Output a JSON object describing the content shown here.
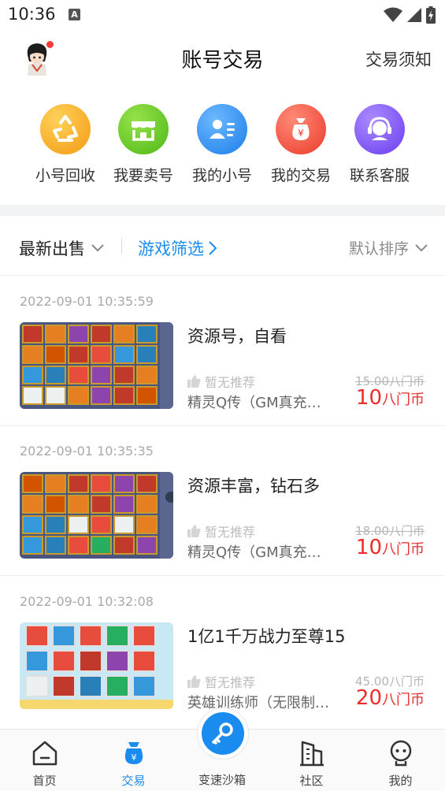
{
  "status_bar": {
    "time": "10:36",
    "a_badge": "A"
  },
  "header": {
    "title": "账号交易",
    "notice": "交易须知"
  },
  "quick_actions": [
    {
      "label": "小号回收",
      "icon": "recycle-icon",
      "color": "#f7a21a"
    },
    {
      "label": "我要卖号",
      "icon": "storefront-icon",
      "color": "#5cc31f"
    },
    {
      "label": "我的小号",
      "icon": "id-card-icon",
      "color": "#2b8bf2"
    },
    {
      "label": "我的交易",
      "icon": "money-bag-icon",
      "color": "#f04a3c"
    },
    {
      "label": "联系客服",
      "icon": "headset-icon",
      "color": "#7c4ff0"
    }
  ],
  "filters": {
    "latest": "最新出售",
    "game_filter": "游戏筛选",
    "sort": "默认排序"
  },
  "listings": [
    {
      "time": "2022-09-01 10:35:59",
      "title": "资源号，自看",
      "recommend": "暂无推荐",
      "game": "精灵Q传（GM真充版）",
      "original_price": "15.00八门币",
      "price": "10",
      "unit": "八门币",
      "strike": true
    },
    {
      "time": "2022-09-01 10:35:35",
      "title": "资源丰富，钻石多",
      "recommend": "暂无推荐",
      "game": "精灵Q传（GM真充版）",
      "original_price": "18.00八门币",
      "price": "10",
      "unit": "八门币",
      "strike": true
    },
    {
      "time": "2022-09-01 10:32:08",
      "title": "1亿1千万战力至尊15",
      "recommend": "暂无推荐",
      "game": "英雄训练师（无限制…",
      "original_price": "45.00八门币",
      "price": "20",
      "unit": "八门币",
      "strike": false
    }
  ],
  "bottom_nav": [
    {
      "label": "首页",
      "icon": "home-icon"
    },
    {
      "label": "交易",
      "icon": "trade-bag-icon"
    },
    {
      "label": "变速沙箱",
      "icon": "key-icon"
    },
    {
      "label": "社区",
      "icon": "building-icon"
    },
    {
      "label": "我的",
      "icon": "profile-face-icon"
    }
  ],
  "colors": {
    "accent": "#1a8cf0",
    "price": "#ee2b2b"
  }
}
